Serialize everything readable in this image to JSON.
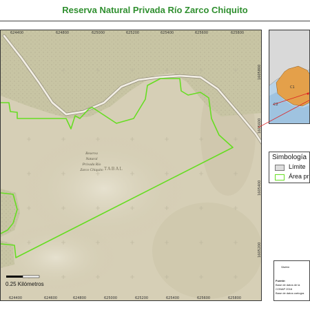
{
  "title": "Reserva Natural Privada Río Zarco Chiquito",
  "map": {
    "x_ticks": [
      "624400",
      "624800",
      "625000",
      "625200",
      "625400",
      "625600",
      "625800"
    ],
    "x_ticks_bottom": [
      "624400",
      "624600",
      "624800",
      "625000",
      "625200",
      "625400",
      "625600",
      "625800"
    ],
    "y_ticks": [
      "1605800",
      "1605600",
      "1605400",
      "1605200"
    ],
    "reserve_label": [
      "Reserva",
      "Natural",
      "Privada Río",
      "Zarco Chiquito"
    ],
    "place_label": "TABAL",
    "scale_label": "0.25 Kilómetros",
    "colors": {
      "boundary": "#66dd22",
      "road": "#f2eee4",
      "forest": "#c5c3a0",
      "terrain": "#d8d2bb"
    }
  },
  "legend": {
    "title": "Simbología",
    "items": [
      {
        "label": "Límite",
        "color": "#dddddd"
      },
      {
        "label": "Área pr",
        "color": "#66dd22"
      }
    ]
  },
  "inset": {
    "labels": [
      "C2",
      "C1"
    ]
  },
  "info": {
    "lines": [
      "Sistem",
      "Fuente:",
      "Base de datos de la",
      "CONAP 2016",
      "Base de datos cartogra"
    ]
  }
}
